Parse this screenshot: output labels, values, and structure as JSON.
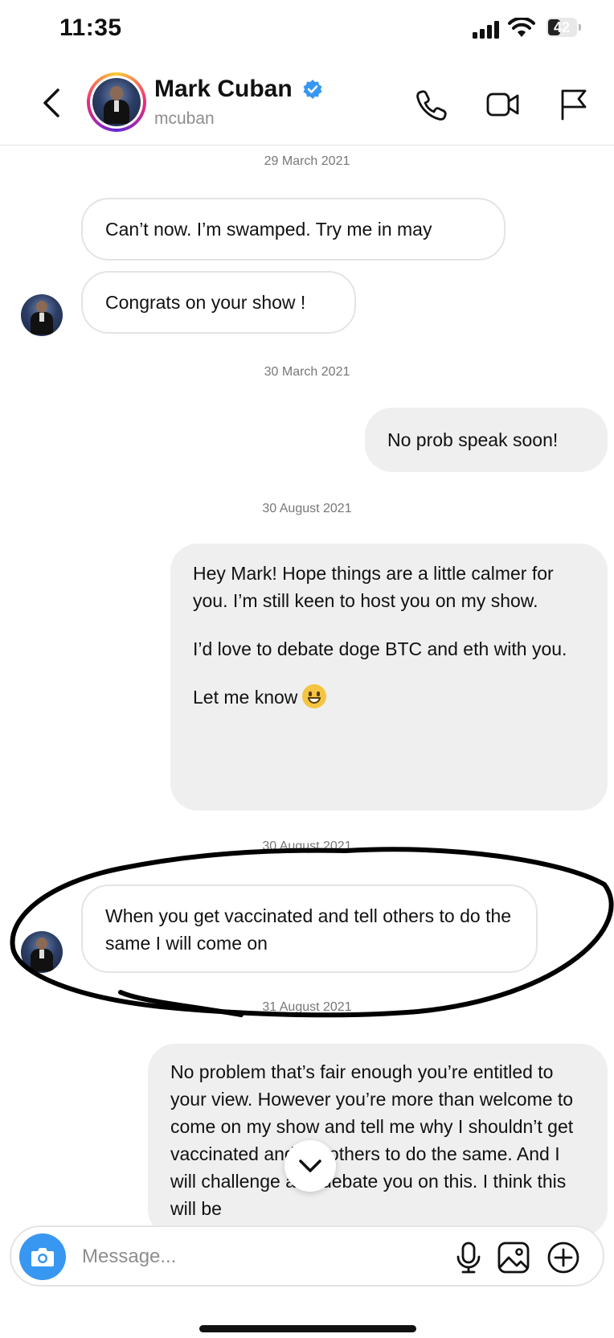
{
  "status_bar": {
    "time": "11:35",
    "battery": "42"
  },
  "header": {
    "display_name": "Mark Cuban",
    "username": "mcuban"
  },
  "thread": {
    "date_1": "29 March 2021",
    "msg_1": "Can’t now. I’m swamped.  Try me in may",
    "msg_2": "Congrats on your show !",
    "date_2": "30 March 2021",
    "msg_3": "No prob speak soon!",
    "date_3": "30 August 2021",
    "msg_4": {
      "p1": "Hey Mark! Hope things are a little calmer for you. I’m still keen to host you on my show.",
      "p2": "I’d love to debate doge BTC and eth with you.",
      "p3": "Let me know"
    },
    "date_4": "30 August 2021",
    "msg_5": "When you get vaccinated and tell others to do the same I will come on",
    "date_5": "31 August 2021",
    "msg_6": "No problem that’s fair enough you’re entitled to your view. However you’re more than welcome to come on my show and tell me why I shouldn’t get vaccinated and tell others to do the same. And I will challenge and debate you on this. I think this will be"
  },
  "composer": {
    "placeholder": "Message..."
  },
  "icons": {
    "back": "chevron-left-icon",
    "verified": "verified-badge-icon",
    "call": "phone-icon",
    "video": "video-camera-icon",
    "report": "flag-icon",
    "camera": "camera-icon",
    "mic": "microphone-icon",
    "gallery": "image-icon",
    "more": "plus-circle-icon",
    "scroll": "chevron-down-icon",
    "emoji": "grinning-face-icon"
  },
  "colors": {
    "accent": "#3897f0",
    "outgoing_bubble": "#efefef",
    "incoming_border": "#e4e4e4",
    "annotation": "#000000"
  }
}
